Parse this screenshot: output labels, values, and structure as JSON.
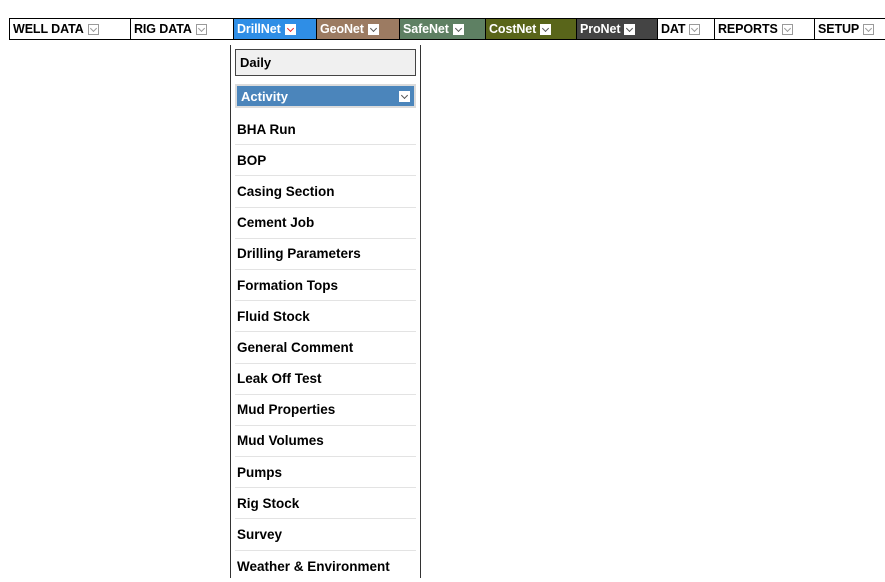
{
  "menubar": {
    "tabs": [
      {
        "label": "WELL DATA"
      },
      {
        "label": "RIG DATA"
      },
      {
        "label": "DrillNet"
      },
      {
        "label": "GeoNet"
      },
      {
        "label": "SafeNet"
      },
      {
        "label": "CostNet"
      },
      {
        "label": "ProNet"
      },
      {
        "label": "DAT"
      },
      {
        "label": "REPORTS"
      },
      {
        "label": "SETUP"
      }
    ],
    "colors": {
      "DrillNet": "#2f8ee6",
      "GeoNet": "#9c7b62",
      "SafeNet": "#5e8063",
      "CostNet": "#59651a",
      "ProNet": "#444444"
    },
    "icon": "chevron-down-icon"
  },
  "dropdown": {
    "daily_label": "Daily",
    "activity_label": "Activity",
    "activity_color": "#4b85bb",
    "items": [
      "BHA Run",
      "BOP",
      "Casing Section",
      "Cement Job",
      "Drilling Parameters",
      "Formation Tops",
      "Fluid Stock",
      "General Comment",
      "Leak Off Test",
      "Mud Properties",
      "Mud Volumes",
      "Pumps",
      "Rig Stock",
      "Survey",
      "Weather & Environment"
    ]
  }
}
